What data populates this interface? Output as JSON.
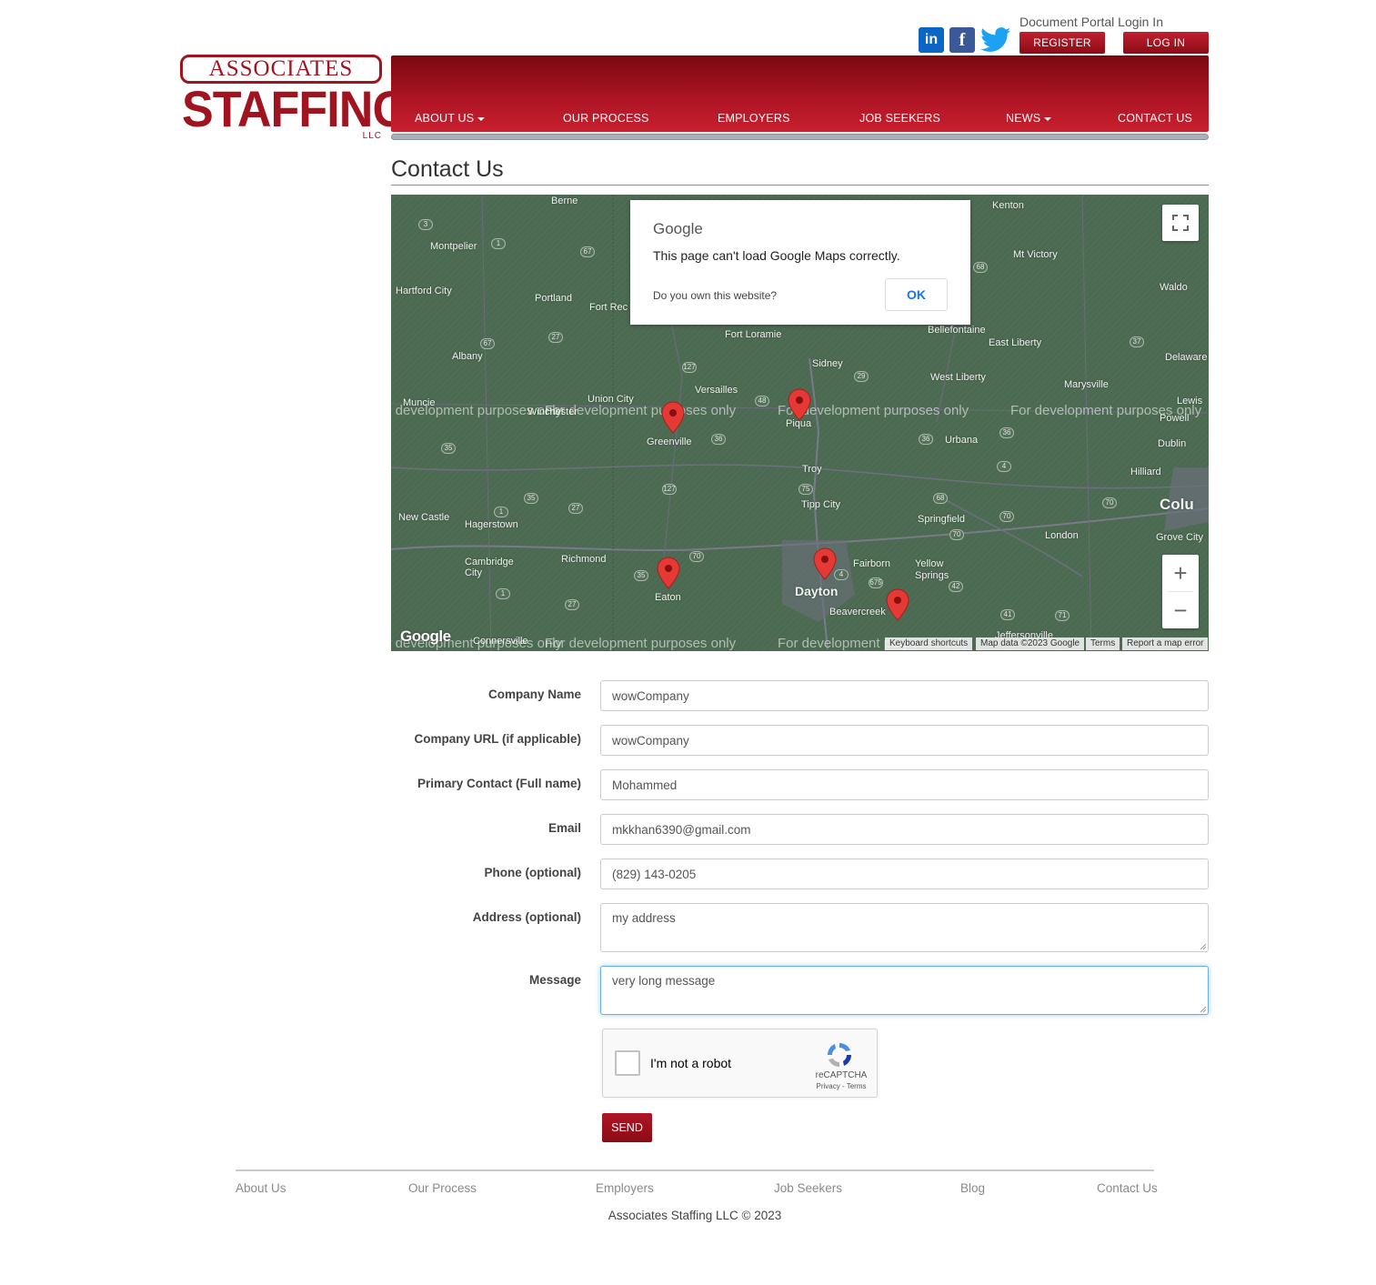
{
  "logo": {
    "line1": "ASSOCIATES",
    "line2": "STAFFING",
    "suffix": "LLC"
  },
  "header": {
    "document_portal": "Document Portal Login In",
    "register": "REGISTER",
    "login": "LOG IN",
    "social": [
      "linkedin-icon",
      "facebook-icon",
      "twitter-icon"
    ],
    "social_glyphs": {
      "linkedin": "in",
      "facebook": "f"
    }
  },
  "nav": {
    "items": [
      {
        "label": "ABOUT US",
        "dropdown": true
      },
      {
        "label": "OUR PROCESS",
        "dropdown": false
      },
      {
        "label": "EMPLOYERS",
        "dropdown": false
      },
      {
        "label": "JOB SEEKERS",
        "dropdown": false
      },
      {
        "label": "NEWS",
        "dropdown": true
      },
      {
        "label": "CONTACT US",
        "dropdown": false
      }
    ]
  },
  "page": {
    "title": "Contact Us"
  },
  "map": {
    "dialog": {
      "brand": "Google",
      "message": "This page can't load Google Maps correctly.",
      "own_site": "Do you own this website?",
      "ok": "OK"
    },
    "watermark": "For development purposes only",
    "places": [
      "Berne",
      "Kenton",
      "Montpelier",
      "Mt Victory",
      "Hartford City",
      "Portland",
      "Fort Rec",
      "Waldo",
      "Fort Loramie",
      "Bellefontaine",
      "East Liberty",
      "Albany",
      "Sidney",
      "West Liberty",
      "Delaware",
      "Versailles",
      "Marysville",
      "Muncie",
      "Union City",
      "Winchester",
      "Greenville",
      "Piqua",
      "Urbana",
      "Lewis",
      "Powell",
      "Dublin",
      "Troy",
      "Hilliard",
      "Tipp City",
      "New Castle",
      "Hagerstown",
      "Springfield",
      "Colu",
      "Grove City",
      "London",
      "Cambridge City",
      "Richmond",
      "Eaton",
      "Fairborn",
      "Yellow Springs",
      "Dayton",
      "Beavercreek",
      "Connersville",
      "Jeffersonville"
    ],
    "routes": [
      "3",
      "1",
      "67",
      "68",
      "27",
      "67",
      "127",
      "37",
      "48",
      "29",
      "35",
      "36",
      "36",
      "36",
      "4",
      "35",
      "127",
      "68",
      "70",
      "1",
      "27",
      "75",
      "70",
      "70",
      "35",
      "70",
      "4",
      "675",
      "42",
      "71",
      "1",
      "27",
      "41"
    ],
    "controls": {
      "zoom_in": "+",
      "zoom_out": "−"
    },
    "google_logo": "Google",
    "attribution": [
      "Keyboard shortcuts",
      "Map data ©2023 Google",
      "Terms",
      "Report a map error"
    ],
    "colors": {
      "land": "#4c6a52",
      "pin": "#e53935"
    }
  },
  "form": {
    "fields": [
      {
        "label": "Company Name",
        "value": "wowCompany"
      },
      {
        "label": "Company URL (if applicable)",
        "value": "wowCompany"
      },
      {
        "label": "Primary Contact (Full name)",
        "value": "Mohammed"
      },
      {
        "label": "Email",
        "value": "mkkhan6390@gmail.com"
      },
      {
        "label": "Phone (optional)",
        "value": "(829) 143-0205"
      },
      {
        "label": "Address (optional)",
        "value": "my address"
      },
      {
        "label": "Message",
        "value": "very long message"
      }
    ],
    "captcha": {
      "label": "I'm not a robot",
      "brand": "reCAPTCHA",
      "links": "Privacy - Terms"
    },
    "send": "SEND"
  },
  "footer": {
    "links": [
      "About Us",
      "Our Process",
      "Employers",
      "Job Seekers",
      "Blog",
      "Contact Us"
    ],
    "copyright": "Associates Staffing LLC © 2023"
  },
  "colors": {
    "brand_red": "#a01420",
    "accent_blue": "#4aa3c8"
  }
}
